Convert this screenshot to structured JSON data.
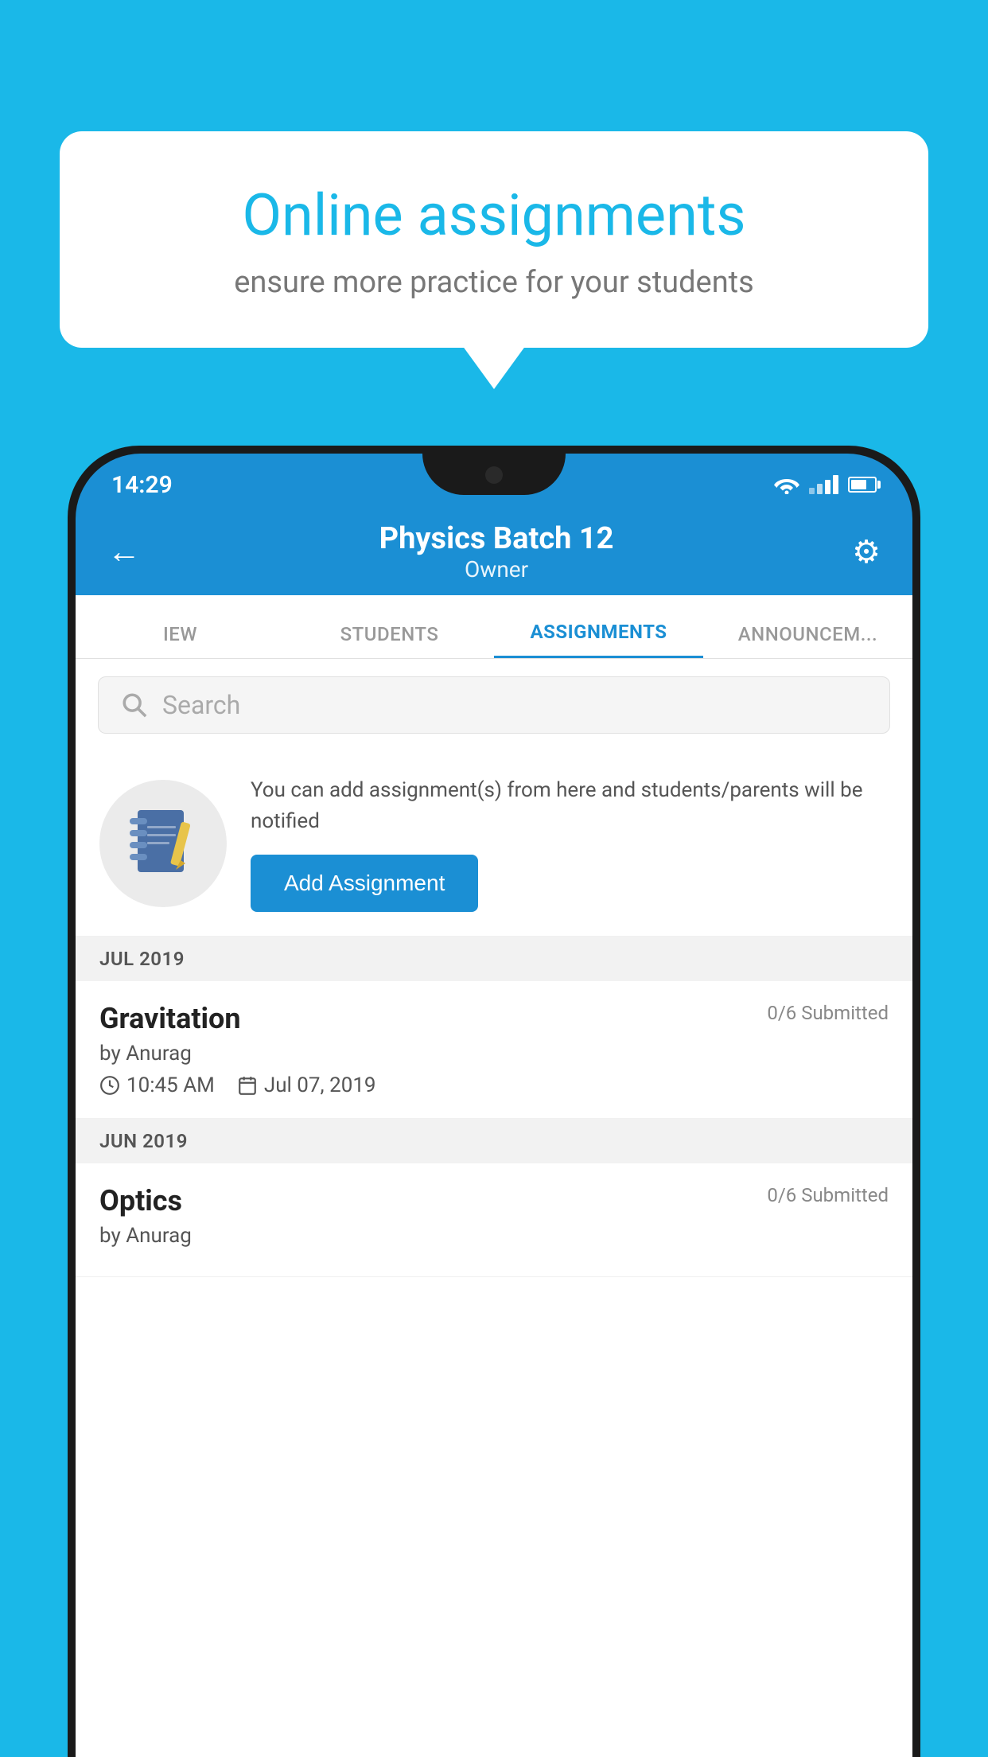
{
  "promo": {
    "title": "Online assignments",
    "subtitle": "ensure more practice for your students"
  },
  "status_bar": {
    "time": "14:29",
    "wifi": "▾",
    "signal": "▲",
    "battery": "battery"
  },
  "header": {
    "title": "Physics Batch 12",
    "subtitle": "Owner",
    "back_label": "←",
    "settings_label": "⚙"
  },
  "tabs": [
    {
      "id": "iew",
      "label": "IEW",
      "active": false
    },
    {
      "id": "students",
      "label": "STUDENTS",
      "active": false
    },
    {
      "id": "assignments",
      "label": "ASSIGNMENTS",
      "active": true
    },
    {
      "id": "announcements",
      "label": "ANNOUNCEM...",
      "active": false
    }
  ],
  "search": {
    "placeholder": "Search"
  },
  "info": {
    "description": "You can add assignment(s) from here and students/parents will be notified",
    "add_button_label": "Add Assignment"
  },
  "sections": [
    {
      "month": "JUL 2019",
      "assignments": [
        {
          "name": "Gravitation",
          "submitted": "0/6 Submitted",
          "by": "by Anurag",
          "time": "10:45 AM",
          "date": "Jul 07, 2019"
        }
      ]
    },
    {
      "month": "JUN 2019",
      "assignments": [
        {
          "name": "Optics",
          "submitted": "0/6 Submitted",
          "by": "by Anurag",
          "time": "",
          "date": ""
        }
      ]
    }
  ]
}
